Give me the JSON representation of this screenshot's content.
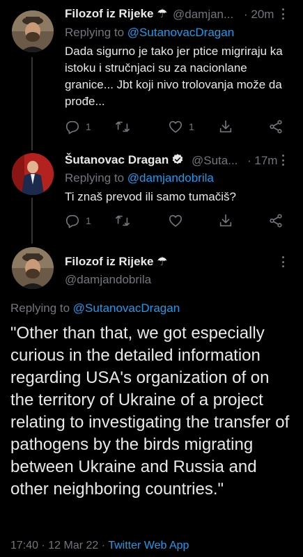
{
  "tweets": [
    {
      "name": "Filozof iz Rijeke",
      "badge": "☂",
      "handle": "@damjan...",
      "time": "· 20m",
      "replying_prefix": "Replying to",
      "replying_to": "@SutanovacDragan",
      "text": "Dada sigurno je tako jer ptice migriraju ka istoku i stručnjaci su za nacionlane granice... Jbt koji nivo trolovanja može da prođe...",
      "reply_count": "1",
      "retweet_count": "",
      "like_count": "1"
    },
    {
      "name": "Šutanovac Dragan",
      "handle": "@Suta...",
      "time": "· 17m",
      "replying_prefix": "Replying to",
      "replying_to": "@damjandobrila",
      "text": "Ti znaš prevod ili samo tumačiš?",
      "reply_count": "1",
      "retweet_count": "",
      "like_count": ""
    }
  ],
  "main_tweet": {
    "name": "Filozof iz Rijeke",
    "badge": "☂",
    "handle": "@damjandobrila",
    "replying_prefix": "Replying to",
    "replying_to": "@SutanovacDragan",
    "text": "\"Other than that, we got especially curious in the detailed information regarding USA's organization of on the territory of Ukraine of a project relating to investigating the transfer of pathogens by the birds migrating between Ukraine and Russia and other neighboring countries.\"",
    "timestamp": "17:40 · 12 Mar 22 · ",
    "source": "Twitter Web App"
  },
  "icons": [
    "reply-icon",
    "retweet-icon",
    "like-icon",
    "share-icon",
    "more-icon",
    "verified-icon"
  ],
  "colors": {
    "background": "#000000",
    "text": "#e7e9ea",
    "muted": "#71767b",
    "link": "#1d9bf0",
    "verified": "#1d9bf0"
  }
}
